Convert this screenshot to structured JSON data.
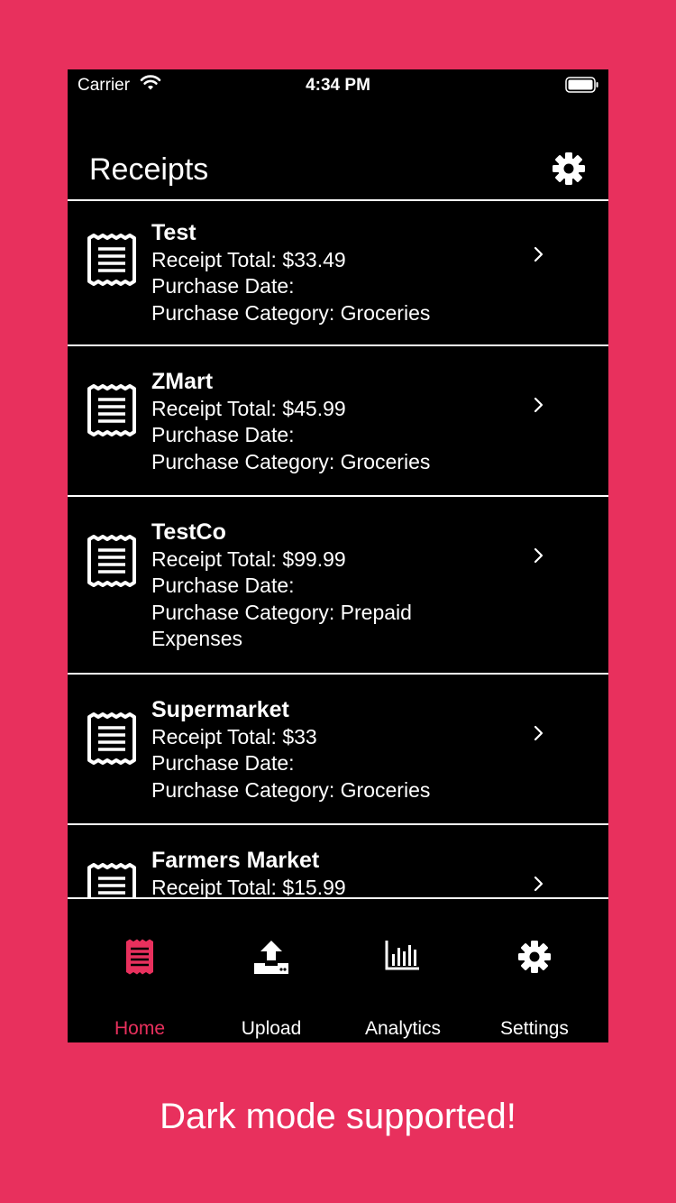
{
  "status_bar": {
    "carrier": "Carrier",
    "time": "4:34 PM"
  },
  "nav": {
    "title": "Receipts",
    "settings_icon": "gear-icon"
  },
  "receipts": [
    {
      "name": "Test",
      "total": "Receipt Total: $33.49",
      "date": "Purchase Date:",
      "category": "Purchase Category: Groceries"
    },
    {
      "name": "ZMart",
      "total": "Receipt Total: $45.99",
      "date": "Purchase Date:",
      "category": "Purchase Category: Groceries"
    },
    {
      "name": "TestCo",
      "total": "Receipt Total: $99.99",
      "date": "Purchase Date:",
      "category": "Purchase Category: Prepaid Expenses"
    },
    {
      "name": "Supermarket",
      "total": "Receipt Total: $33",
      "date": "Purchase Date:",
      "category": "Purchase Category: Groceries"
    },
    {
      "name": "Farmers Market",
      "total": "Receipt Total: $15.99",
      "date": "",
      "category": ""
    }
  ],
  "tabs": [
    {
      "label": "Home",
      "icon": "receipt-icon",
      "active": true
    },
    {
      "label": "Upload",
      "icon": "upload-icon",
      "active": false
    },
    {
      "label": "Analytics",
      "icon": "analytics-icon",
      "active": false
    },
    {
      "label": "Settings",
      "icon": "gear-icon",
      "active": false
    }
  ],
  "caption": "Dark mode supported!",
  "colors": {
    "accent": "#E8305D",
    "background": "#000000",
    "text": "#FFFFFF"
  }
}
